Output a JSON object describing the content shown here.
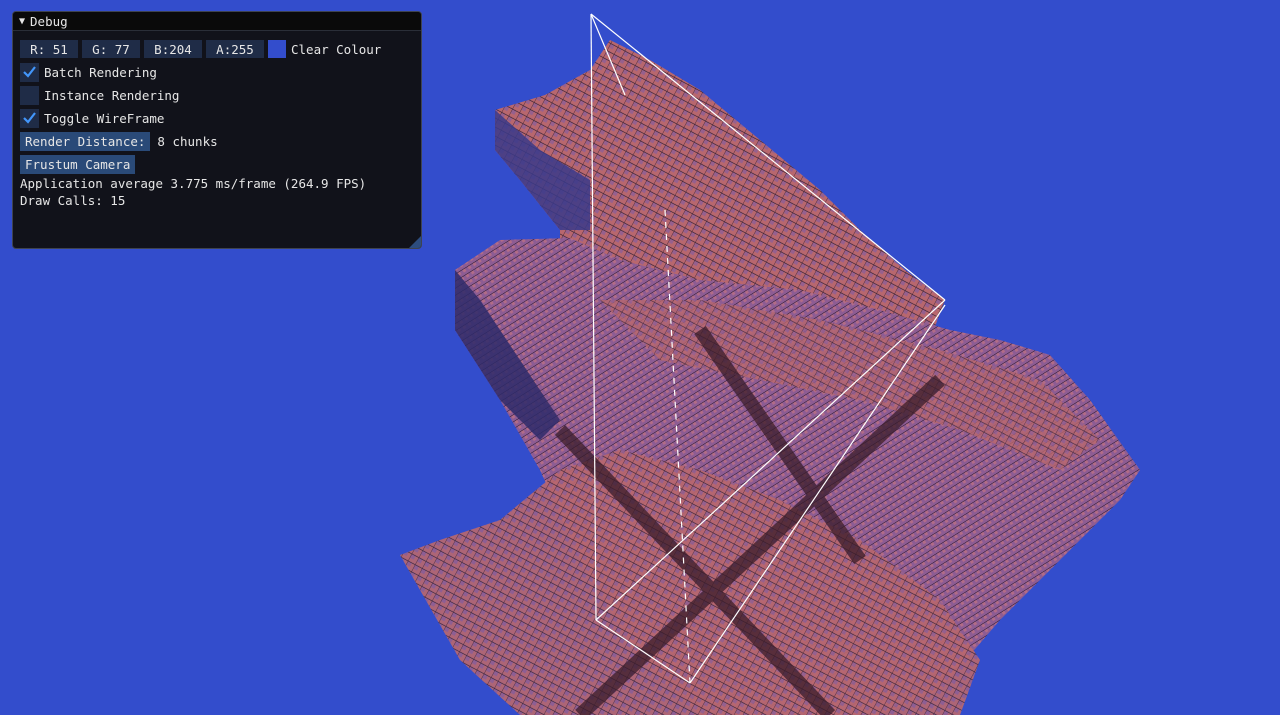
{
  "background_color": "#334dcc",
  "debug_window": {
    "title": "Debug",
    "clear_colour": {
      "r": "R: 51",
      "g": "G: 77",
      "b": "B:204",
      "a": "A:255",
      "swatch_color": "#334dcc",
      "label": "Clear Colour"
    },
    "checkboxes": [
      {
        "label": "Batch Rendering",
        "checked": true
      },
      {
        "label": "Instance Rendering",
        "checked": false
      },
      {
        "label": "Toggle WireFrame",
        "checked": true
      }
    ],
    "render_distance": {
      "button_label": "Render Distance:",
      "value": "8 chunks"
    },
    "frustum_button": "Frustum Camera",
    "stats": {
      "fps_line": "Application average 3.775 ms/frame (264.9 FPS)",
      "draw_calls_line": "Draw Calls: 15"
    }
  },
  "scene": {
    "terrain_color": "#c06a6a",
    "wireframe_color": "#ffffff"
  }
}
